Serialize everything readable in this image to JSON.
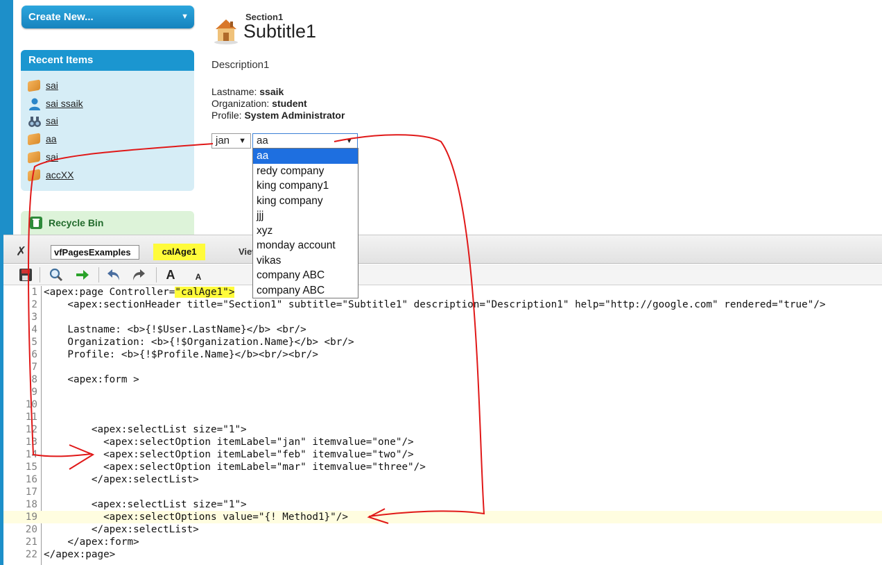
{
  "sidebar": {
    "create_new_label": "Create New...",
    "recent_items_title": "Recent Items",
    "recent_items": [
      {
        "label": "sai",
        "icon": "account-box-icon"
      },
      {
        "label": "sai ssaik",
        "icon": "person-icon"
      },
      {
        "label": "sai",
        "icon": "binoculars-icon"
      },
      {
        "label": "aa",
        "icon": "account-box-icon"
      },
      {
        "label": "sai",
        "icon": "account-box-icon"
      },
      {
        "label": "accXX",
        "icon": "account-box-icon"
      }
    ],
    "recycle_bin_label": "Recycle Bin"
  },
  "section_header": {
    "title": "Section1",
    "subtitle": "Subtitle1",
    "description": "Description1"
  },
  "user_info": {
    "lastname_label": "Lastname:",
    "lastname_value": "ssaik",
    "organization_label": "Organization:",
    "organization_value": "student",
    "profile_label": "Profile:",
    "profile_value": "System Administrator"
  },
  "month_select": {
    "value": "jan"
  },
  "account_select": {
    "value": "aa",
    "options": [
      "aa",
      "redy company",
      "king company1",
      "king company",
      "jjj",
      "xyz",
      "monday account",
      "vikas",
      "company ABC",
      "company ABC"
    ]
  },
  "console": {
    "tabs": [
      "vfPagesExamples",
      "calAge1"
    ],
    "view_label": "View",
    "highlighted_line": 19,
    "code_lines": [
      "<apex:page Controller=\"calAge1\">",
      "    <apex:sectionHeader title=\"Section1\" subtitle=\"Subtitle1\" description=\"Description1\" help=\"http://google.com\" rendered=\"true\"/>",
      "",
      "    Lastname: <b>{!$User.LastName}</b> <br/>",
      "    Organization: <b>{!$Organization.Name}</b> <br/>",
      "    Profile: <b>{!$Profile.Name}</b><br/><br/>",
      "",
      "    <apex:form >",
      "",
      "",
      "",
      "        <apex:selectList size=\"1\">",
      "          <apex:selectOption itemLabel=\"jan\" itemvalue=\"one\"/>",
      "          <apex:selectOption itemLabel=\"feb\" itemvalue=\"two\"/>",
      "          <apex:selectOption itemLabel=\"mar\" itemvalue=\"three\"/>",
      "        </apex:selectList>",
      "",
      "        <apex:selectList size=\"1\">",
      "          <apex:selectOptions value=\"{! Method1}\"/>",
      "        </apex:selectList>",
      "    </apex:form>",
      "</apex:page>"
    ]
  },
  "colors": {
    "accent_blue": "#1b96d0",
    "recent_bg": "#d6edf6",
    "recycle_bg": "#ddf3d9",
    "highlight_yellow": "#fffb3a",
    "annotation_red": "#e01818",
    "dropdown_selected": "#1e6fe0"
  }
}
